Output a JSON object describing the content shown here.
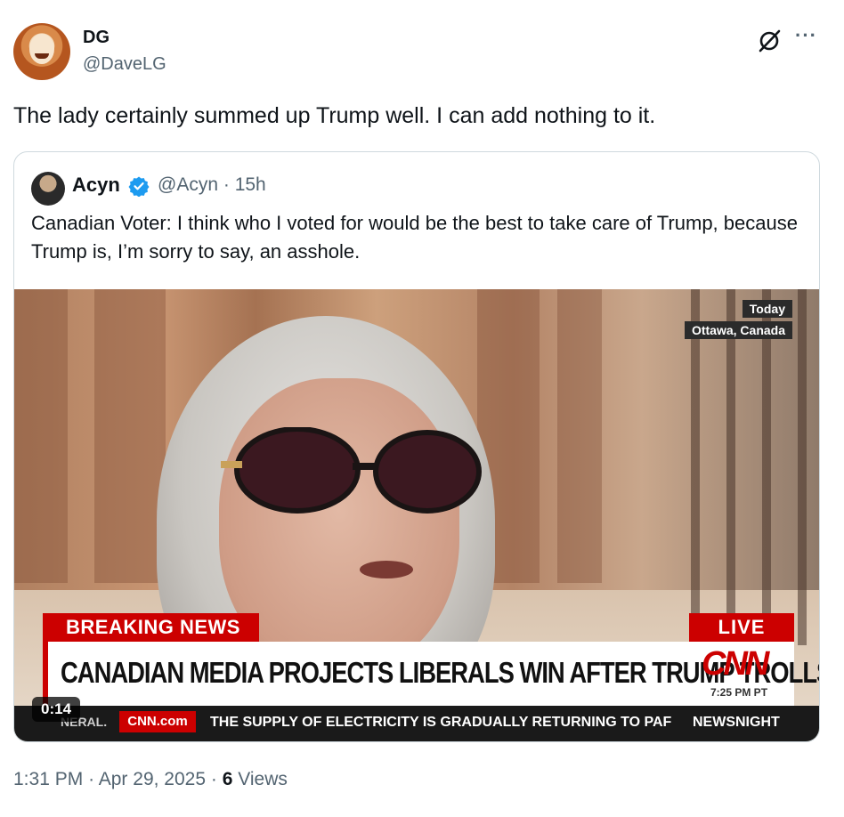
{
  "tweet": {
    "author_name": "DG",
    "author_handle": "@DaveLG",
    "text": "The lady certainly summed up Trump well. I can add nothing to it.",
    "time": "1:31 PM",
    "date": "Apr 29, 2025",
    "separator": "·",
    "views_count": "6",
    "views_label": "Views",
    "more_label": "···"
  },
  "quoted": {
    "author_name": "Acyn",
    "author_handle": "@Acyn",
    "age": "15h",
    "separator": "·",
    "text": "Canadian Voter: I think who I voted for would be the best to take care of Trump, because Trump is, I’m sorry to say, an asshole."
  },
  "video": {
    "location_top": "Today",
    "location_city": "Ottawa, Canada",
    "breaking_label": "BREAKING NEWS",
    "live_label": "LIVE",
    "headline": "CANADIAN MEDIA PROJECTS LIBERALS WIN AFTER TRUMP TROLLS",
    "network_logo": "CNN",
    "time_tag": "7:25 PM PT",
    "ticker_left": "NERAL.",
    "ticker_site": "CNN.com",
    "ticker_text": "THE SUPPLY OF ELECTRICITY IS GRADUALLY RETURNING TO PAF",
    "ticker_show": "NEWSNIGHT",
    "duration": "0:14"
  },
  "colors": {
    "accent_blue": "#1d9bf0",
    "cnn_red": "#cc0000",
    "secondary_text": "#536471"
  },
  "icons": [
    "grok-icon",
    "more-icon",
    "verified-badge-icon"
  ]
}
